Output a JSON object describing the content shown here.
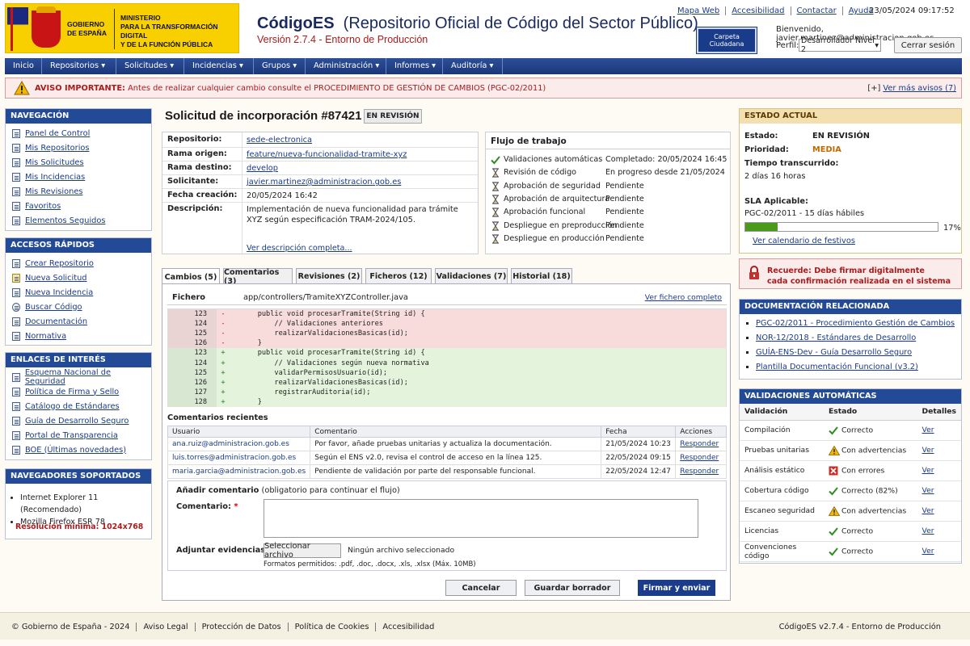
{
  "header": {
    "gov_line1": "GOBIERNO",
    "gov_line2": "DE ESPAÑA",
    "ministry_line1": "MINISTERIO",
    "ministry_line2": "PARA LA TRANSFORMACIÓN DIGITAL",
    "ministry_line3": "Y DE LA FUNCIÓN PÚBLICA",
    "app_name": "CódigoES",
    "app_subtitle": "(Repositorio Oficial de Código del Sector Público)",
    "version": "Versión 2.7.4 - Entorno de Producción",
    "carpeta_label": "Carpeta Ciudadana",
    "top_links": [
      "Mapa Web",
      "Accesibilidad",
      "Contactar",
      "Ayuda"
    ],
    "datetime": "23/05/2024 09:17:52",
    "welcome": "Bienvenido, javier.martinez@administracion.gob.es",
    "perfil_label": "Perfil:",
    "perfil_value": "Desarrollador Nivel 2",
    "logout": "Cerrar sesión"
  },
  "nav": [
    "Inicio",
    "Repositorios ▾",
    "Solicitudes ▾",
    "Incidencias ▾",
    "Grupos ▾",
    "Administración ▾",
    "Informes ▾",
    "Auditoría ▾"
  ],
  "alert": {
    "bold": "AVISO IMPORTANTE:",
    "text": "Antes de realizar cualquier cambio consulte el PROCEDIMIENTO DE GESTIÓN DE CAMBIOS (PGC-02/2011)",
    "more_prefix": "[+]",
    "more": "Ver más avisos (7)"
  },
  "sidebar": {
    "nav_title": "NAVEGACIÓN",
    "nav_items": [
      "Panel de Control",
      "Mis Repositorios",
      "Mis Solicitudes",
      "Mis Incidencias",
      "Mis Revisiones",
      "Favoritos",
      "Elementos Seguidos"
    ],
    "quick_title": "ACCESOS RÁPIDOS",
    "quick_items": [
      "Crear Repositorio",
      "Nueva Solicitud",
      "Nueva Incidencia",
      "Buscar Código",
      "Documentación",
      "Normativa"
    ],
    "links_title": "ENLACES DE INTERÉS",
    "links_items": [
      "Esquema Nacional de Seguridad",
      "Política de Firma y Sello",
      "Catálogo de Estándares",
      "Guía de Desarrollo Seguro",
      "Portal de Transparencia",
      "BOE (Últimas novedades)"
    ],
    "browsers_title": "NAVEGADORES SOPORTADOS",
    "browsers": [
      "Internet Explorer 11 (Recomendado)",
      "Mozilla Firefox ESR 78"
    ],
    "resolution": "Resolución mínima: 1024x768"
  },
  "main": {
    "title": "Solicitud de incorporación #87421",
    "badge": "EN REVISIÓN",
    "info": [
      {
        "k": "Repositorio:",
        "v": "sede-electronica",
        "link": true
      },
      {
        "k": "Rama origen:",
        "v": "feature/nueva-funcionalidad-tramite-xyz",
        "link": true
      },
      {
        "k": "Rama destino:",
        "v": "develop",
        "link": true
      },
      {
        "k": "Solicitante:",
        "v": "javier.martinez@administracion.gob.es",
        "link": true
      },
      {
        "k": "Fecha creación:",
        "v": "20/05/2024 16:42",
        "link": false
      },
      {
        "k": "Descripción:",
        "v": "Implementación de nueva funcionalidad para trámite XYZ según especificación TRAM-2024/105.",
        "link": false
      }
    ],
    "desc_link": "Ver descripción completa...",
    "workflow_title": "Flujo de trabajo",
    "workflow": [
      {
        "icon": "check-icon",
        "name": "Validaciones automáticas",
        "status": "Completado: 20/05/2024 16:45"
      },
      {
        "icon": "hourglass-icon",
        "name": "Revisión de código",
        "status": "En progreso desde 21/05/2024"
      },
      {
        "icon": "hourglass-icon",
        "name": "Aprobación de seguridad",
        "status": "Pendiente"
      },
      {
        "icon": "hourglass-icon",
        "name": "Aprobación de arquitectura",
        "status": "Pendiente"
      },
      {
        "icon": "hourglass-icon",
        "name": "Aprobación funcional",
        "status": "Pendiente"
      },
      {
        "icon": "hourglass-icon",
        "name": "Despliegue en preproducción",
        "status": "Pendiente"
      },
      {
        "icon": "hourglass-icon",
        "name": "Despliegue en producción",
        "status": "Pendiente"
      }
    ],
    "tabs": [
      "Cambios (5)",
      "Comentarios (3)",
      "Revisiones (2)",
      "Ficheros (12)",
      "Validaciones (7)",
      "Historial (18)"
    ],
    "file_label": "Fichero",
    "file_path": "app/controllers/TramiteXYZController.java",
    "file_link": "Ver fichero completo",
    "code": [
      {
        "type": "del",
        "n": "123",
        "g": "-",
        "t": "    public void procesarTramite(String id) {"
      },
      {
        "type": "del",
        "n": "124",
        "g": "-",
        "t": "        // Validaciones anteriores"
      },
      {
        "type": "del",
        "n": "125",
        "g": "-",
        "t": "        realizarValidacionesBasicas(id);"
      },
      {
        "type": "del",
        "n": "126",
        "g": "-",
        "t": "    }"
      },
      {
        "type": "add",
        "n": "123",
        "g": "+",
        "t": "    public void procesarTramite(String id) {"
      },
      {
        "type": "add",
        "n": "124",
        "g": "+",
        "t": "        // Validaciones según nueva normativa"
      },
      {
        "type": "add",
        "n": "125",
        "g": "+",
        "t": "        validarPermisosUsuario(id);"
      },
      {
        "type": "add",
        "n": "126",
        "g": "+",
        "t": "        realizarValidacionesBasicas(id);"
      },
      {
        "type": "add",
        "n": "127",
        "g": "+",
        "t": "        registrarAuditoria(id);"
      },
      {
        "type": "add",
        "n": "128",
        "g": "+",
        "t": "    }"
      }
    ],
    "comments_title": "Comentarios recientes",
    "comments_headers": [
      "Usuario",
      "Comentario",
      "Fecha",
      "Acciones"
    ],
    "comments": [
      {
        "user": "ana.ruiz@administracion.gob.es",
        "text": "Por favor, añade pruebas unitarias y actualiza la documentación.",
        "date": "21/05/2024 10:23",
        "action": "Responder"
      },
      {
        "user": "luis.torres@administracion.gob.es",
        "text": "Según el ENS v2.0, revisa el control de acceso en la línea 125.",
        "date": "22/05/2024 09:15",
        "action": "Responder"
      },
      {
        "user": "maria.garcia@administracion.gob.es",
        "text": "Pendiente de validación por parte del responsable funcional.",
        "date": "22/05/2024 12:47",
        "action": "Responder"
      }
    ],
    "add_title": "Añadir comentario",
    "add_note": "(obligatorio para continuar el flujo)",
    "comment_label": "Comentario:",
    "required_mark": "*",
    "attach_label": "Adjuntar evidencias:",
    "file_button": "Seleccionar archivo",
    "no_file": "Ningún archivo seleccionado",
    "formats": "Formatos permitidos: .pdf, .doc, .docx, .xls, .xlsx (Máx. 10MB)",
    "cancel": "Cancelar",
    "draft": "Guardar borrador",
    "sign": "Firmar y enviar"
  },
  "right": {
    "status_title": "ESTADO ACTUAL",
    "estado_k": "Estado:",
    "estado_v": "EN REVISIÓN",
    "prioridad_k": "Prioridad:",
    "prioridad_v": "MEDIA",
    "tiempo_k": "Tiempo transcurrido:",
    "tiempo_v": "2 días 16 horas",
    "sla_k": "SLA Aplicable:",
    "sla_v": "PGC-02/2011 - 15 días hábiles",
    "sla_percent": 17,
    "sla_percent_label": "17%",
    "calendar_link": "Ver calendario de festivos",
    "remember_line1": "Recuerde: Debe firmar digitalmente",
    "remember_line2": "cada confirmación realizada en el sistema",
    "docs_title": "DOCUMENTACIÓN RELACIONADA",
    "docs": [
      "PGC-02/2011 - Procedimiento Gestión de Cambios",
      "NOR-12/2018 - Estándares de Desarrollo",
      "GUÍA-ENS-Dev - Guía Desarrollo Seguro",
      "Plantilla Documentación Funcional (v3.2)"
    ],
    "vals_title": "VALIDACIONES AUTOMÁTICAS",
    "vals_headers": [
      "Validación",
      "Estado",
      "Detalles"
    ],
    "vals": [
      {
        "name": "Compilación",
        "icon": "check-icon",
        "status": "Correcto",
        "link": "Ver"
      },
      {
        "name": "Pruebas unitarias",
        "icon": "warning-icon",
        "status": "Con advertencias",
        "link": "Ver"
      },
      {
        "name": "Análisis estático",
        "icon": "error-icon",
        "status": "Con errores",
        "link": "Ver"
      },
      {
        "name": "Cobertura código",
        "icon": "check-icon",
        "status": "Correcto (82%)",
        "link": "Ver"
      },
      {
        "name": "Escaneo seguridad",
        "icon": "warning-icon",
        "status": "Con advertencias",
        "link": "Ver"
      },
      {
        "name": "Licencias",
        "icon": "check-icon",
        "status": "Correcto",
        "link": "Ver"
      },
      {
        "name": "Convenciones código",
        "icon": "check-icon",
        "status": "Correcto",
        "link": "Ver"
      }
    ]
  },
  "footer": {
    "left": [
      "© Gobierno de España - 2024",
      "Aviso Legal",
      "Protección de Datos",
      "Política de Cookies",
      "Accesibilidad"
    ],
    "right": "CódigoES v2.7.4 - Entorno de Producción"
  },
  "colors": {
    "primary": "#234a96",
    "alert": "#a81c1c",
    "success": "#4b9a1c"
  }
}
